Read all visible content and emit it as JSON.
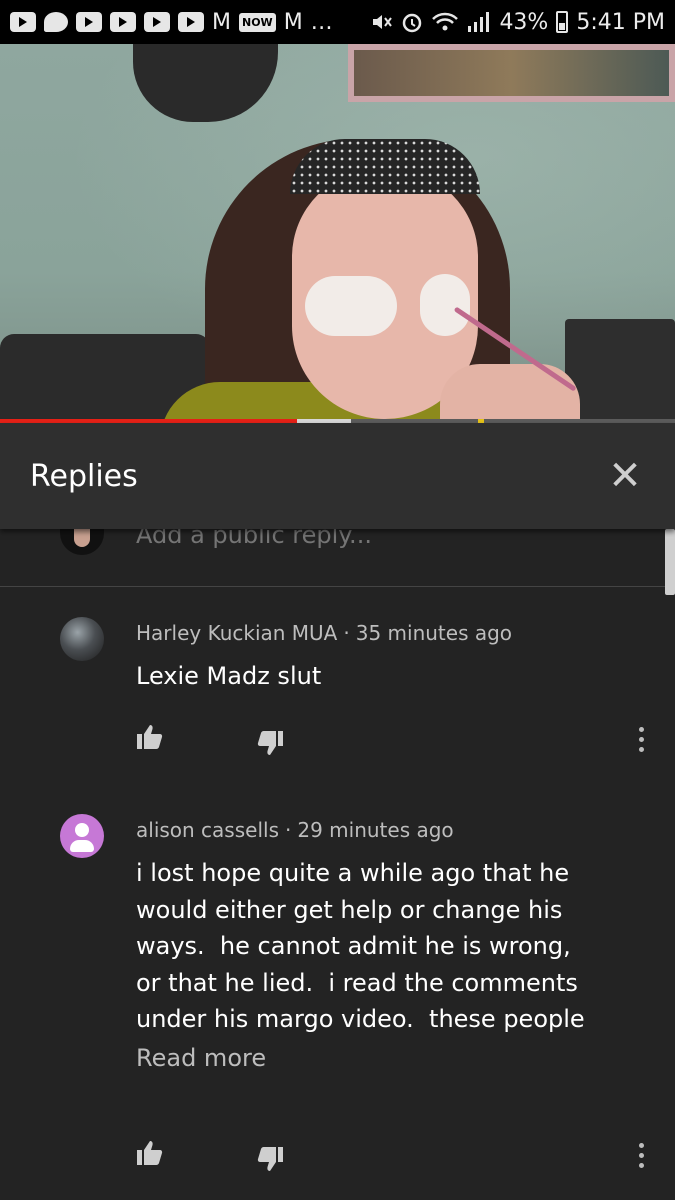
{
  "status_bar": {
    "left_letters": [
      "M",
      "M"
    ],
    "now_badge": "NOW",
    "dots": "…",
    "battery": "43%",
    "time": "5:41 PM"
  },
  "video": {
    "progress_played_fraction": 0.44,
    "progress_buffered_end_fraction": 0.52
  },
  "replies_panel": {
    "title": "Replies",
    "close_glyph": "✕",
    "reply_placeholder": "Add a public reply..."
  },
  "comments": [
    {
      "author": "Harley Kuckian MUA",
      "time": "35 minutes ago",
      "text": "Lexie Madz slut"
    },
    {
      "author": "alison cassells",
      "time": "29 minutes ago",
      "text": "i lost hope quite a while ago that he\nwould either get help or change his\nways.  he cannot admit he is wrong,\nor that he lied.  i read the comments\nunder his margo video.  these people",
      "read_more": "Read more"
    }
  ],
  "colors": {
    "background": "#232323",
    "header": "#2f2f2f",
    "progress_played": "#e62117",
    "default_avatar": "#c678d6"
  },
  "icons": [
    "play-icon",
    "message-icon",
    "wifi-icon",
    "signal-icon",
    "battery-icon",
    "close-icon",
    "thumbs-up-icon",
    "thumbs-down-icon",
    "more-vert-icon",
    "person-icon"
  ]
}
